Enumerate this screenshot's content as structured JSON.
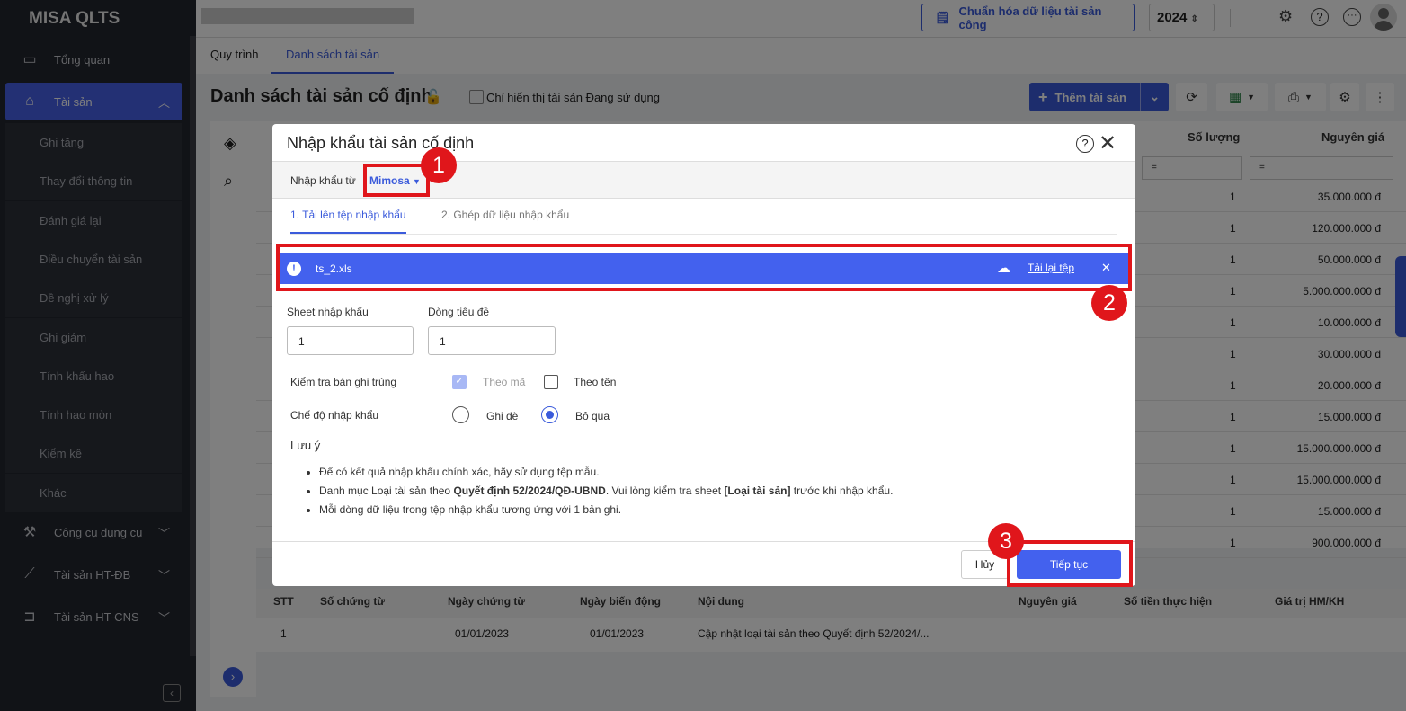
{
  "sidebar": {
    "logo": "MISA QLTS",
    "overview": "Tổng quan",
    "assets": "Tài sản",
    "sub": [
      "Ghi tăng",
      "Thay đổi thông tin",
      "Đánh giá lại",
      "Điều chuyển tài sản",
      "Đề nghị xử lý",
      "Ghi giảm",
      "Tính khấu hao",
      "Tính hao mòn",
      "Kiểm kê",
      "Khác"
    ],
    "tools": "Công cụ dụng cụ",
    "ht_db": "Tài sản HT-ĐB",
    "ht_cns": "Tài sản HT-CNS"
  },
  "topbar": {
    "normalize": "Chuẩn hóa dữ liệu tài sản công",
    "year": "2024"
  },
  "tabs": [
    "Quy trình",
    "Danh sách tài sản"
  ],
  "page": {
    "title": "Danh sách tài sản cố định",
    "filter": "Chỉ hiển thị tài sản Đang sử dụng",
    "add": "Thêm tài sản"
  },
  "grid": {
    "headers": [
      "Số lượng",
      "Nguyên giá"
    ],
    "filter_op": "=",
    "rows": [
      [
        "1",
        "35.000.000 đ"
      ],
      [
        "1",
        "120.000.000 đ"
      ],
      [
        "1",
        "50.000.000 đ"
      ],
      [
        "1",
        "5.000.000.000 đ"
      ],
      [
        "1",
        "10.000.000 đ"
      ],
      [
        "1",
        "30.000.000 đ"
      ],
      [
        "1",
        "20.000.000 đ"
      ],
      [
        "1",
        "15.000.000 đ"
      ],
      [
        "1",
        "15.000.000.000 đ"
      ],
      [
        "1",
        "15.000.000.000 đ"
      ],
      [
        "1",
        "15.000.000 đ"
      ],
      [
        "1",
        "900.000.000 đ"
      ]
    ]
  },
  "detail": {
    "headers": [
      "STT",
      "Số chứng từ",
      "Ngày chứng từ",
      "Ngày biến động",
      "Nội dung",
      "Nguyên giá",
      "Số tiền thực hiện",
      "Giá trị HM/KH"
    ],
    "row": [
      "1",
      "",
      "01/01/2023",
      "01/01/2023",
      "Cập nhật loại tài sản theo Quyết định 52/2024/..."
    ]
  },
  "modal": {
    "title": "Nhập khẩu tài sản cố định",
    "source_label": "Nhập khẩu từ",
    "source": "Mimosa",
    "steps": [
      "1. Tải lên tệp nhập khẩu",
      "2. Ghép dữ liệu nhập khẩu"
    ],
    "file": "ts_2.xls",
    "reload": "Tải lại tệp",
    "sheet_label": "Sheet nhập khẩu",
    "sheet": "1",
    "header_label": "Dòng tiêu đề",
    "header": "1",
    "dup_label": "Kiểm tra bản ghi trùng",
    "by_code": "Theo mã",
    "by_name": "Theo tên",
    "mode_label": "Chế độ nhập khẩu",
    "overwrite": "Ghi đè",
    "skip": "Bỏ qua",
    "note_title": "Lưu ý",
    "note1": "Để có kết quả nhập khẩu chính xác, hãy sử dụng tệp mẫu.",
    "note2a": "Danh mục Loại tài sản theo ",
    "note2b": "Quyết định 52/2024/QĐ-UBND",
    "note2c": ". Vui lòng kiểm tra sheet ",
    "note2d": "[Loại tài sản]",
    "note2e": " trước khi nhập khẩu.",
    "note3": "Mỗi dòng dữ liệu trong tệp nhập khẩu tương ứng với 1 bản ghi.",
    "cancel": "Hủy",
    "continue": "Tiếp tục"
  },
  "annotations": [
    "1",
    "2",
    "3"
  ],
  "colors": {
    "primary": "#4361ee",
    "highlight": "#e0161b"
  }
}
